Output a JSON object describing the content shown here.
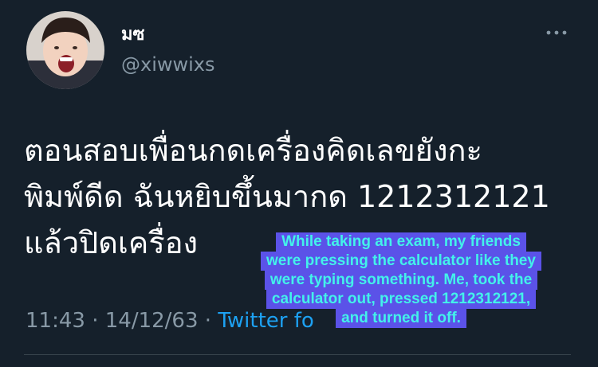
{
  "user": {
    "display_name": "มซ",
    "handle": "@xiwwixs",
    "avatar_icon": "user-avatar-photo"
  },
  "more_icon": "ellipsis-icon",
  "tweet": {
    "lines": [
      "ตอนสอบเพื่อนกดเครื่องคิดเลขยังกะ",
      "พิมพ์ดีด ฉันหยิบขึ้นมากด 1212312121",
      "แล้วปิดเครื่อง"
    ]
  },
  "meta": {
    "time": "11:43",
    "separator1": " · ",
    "date": "14/12/63",
    "separator2": " · ",
    "source": "Twitter fo"
  },
  "translation": {
    "lines": [
      "While taking an exam, my friends",
      "were pressing the calculator like they",
      "were typing something. Me, took the",
      "calculator out, pressed 1212312121,",
      "and turned it off."
    ]
  },
  "colors": {
    "background": "#15202b",
    "secondary_text": "#8899a6",
    "link": "#1da1f2",
    "caption_bg": "#5b52e8",
    "caption_text": "#43f2ea"
  }
}
